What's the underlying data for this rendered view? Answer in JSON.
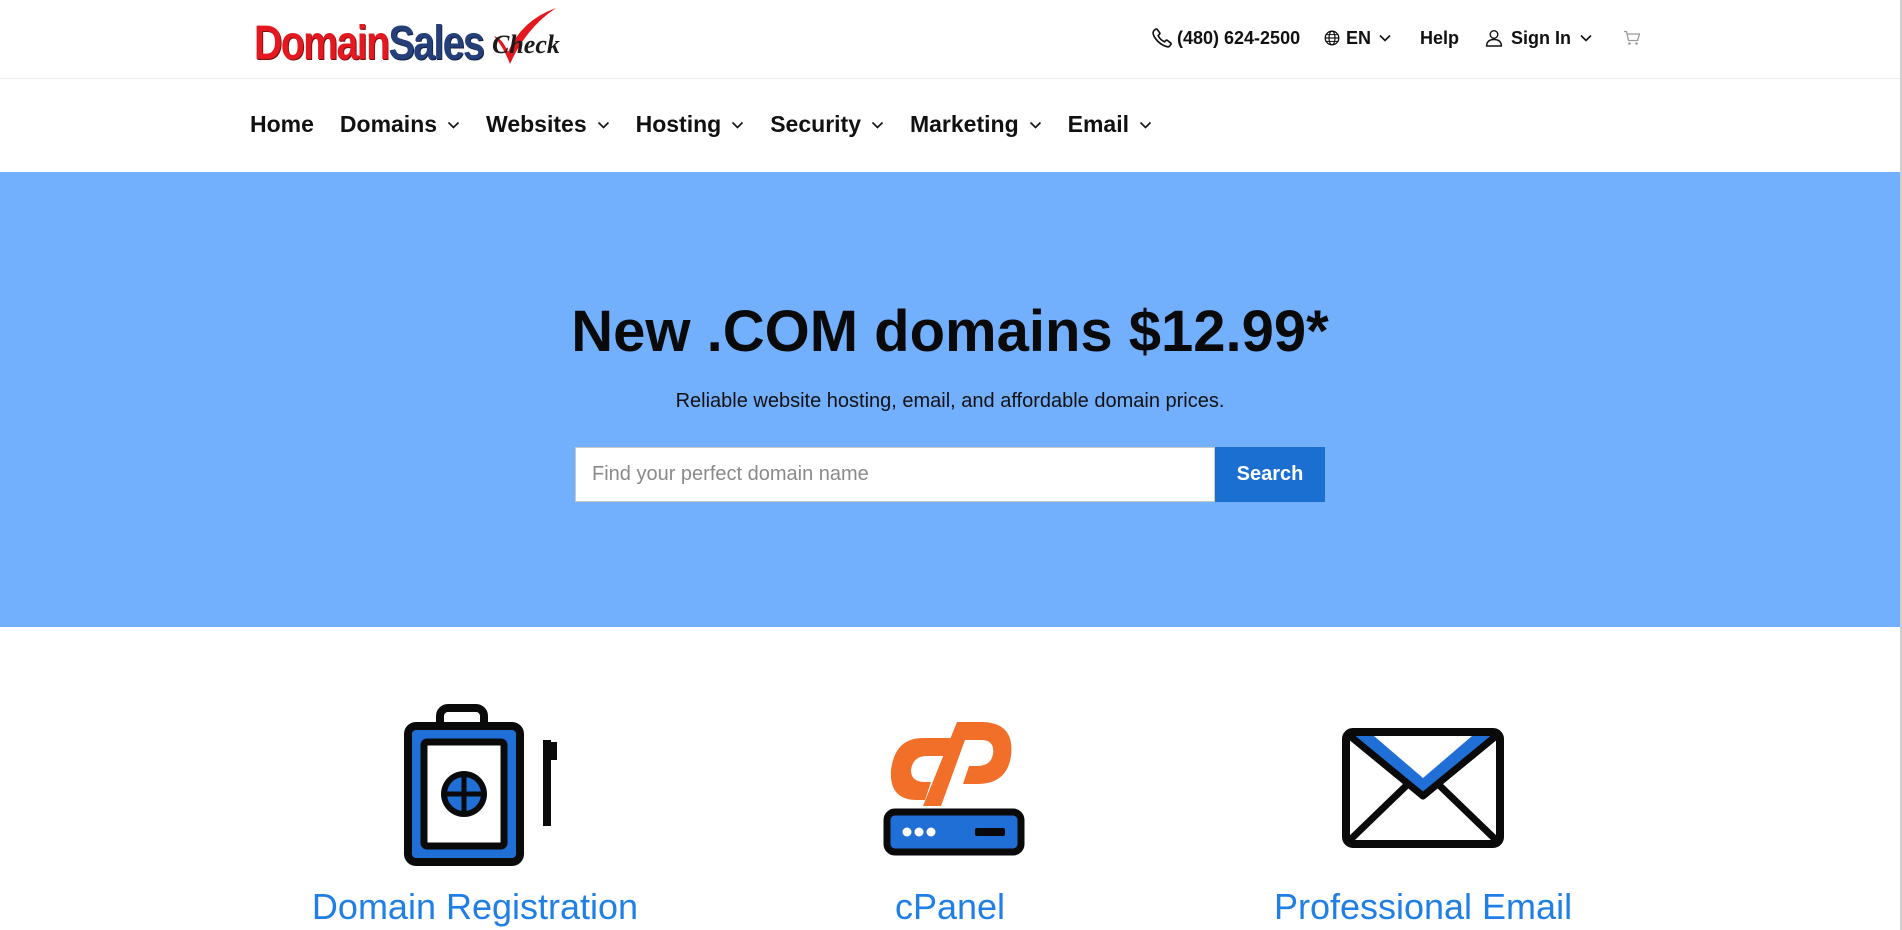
{
  "brand": {
    "logo_part1": "Domain",
    "logo_part2": "Sales",
    "logo_part3": "Check",
    "red": "#e3191f",
    "navy": "#243f7a"
  },
  "utility_nav": {
    "phone": "(480) 624-2500",
    "language": "EN",
    "help": "Help",
    "sign_in": "Sign In",
    "icons": [
      "phone-icon",
      "globe-icon",
      "user-icon",
      "cart-icon",
      "chevron-down-icon"
    ]
  },
  "main_nav": {
    "items": [
      {
        "label": "Home",
        "has_dropdown": false
      },
      {
        "label": "Domains",
        "has_dropdown": true
      },
      {
        "label": "Websites",
        "has_dropdown": true
      },
      {
        "label": "Hosting",
        "has_dropdown": true
      },
      {
        "label": "Security",
        "has_dropdown": true
      },
      {
        "label": "Marketing",
        "has_dropdown": true
      },
      {
        "label": "Email",
        "has_dropdown": true
      }
    ]
  },
  "hero": {
    "title": "New .COM domains $12.99*",
    "subtitle": "Reliable website hosting, email, and affordable domain prices.",
    "search_placeholder": "Find your perfect domain name",
    "search_value": "",
    "search_button": "Search",
    "background": "#72affd",
    "button_color": "#1a6fd0"
  },
  "products": [
    {
      "label": "Domain Registration",
      "icon": "domain-registration-icon"
    },
    {
      "label": "cPanel",
      "icon": "cpanel-icon"
    },
    {
      "label": "Professional Email",
      "icon": "envelope-icon"
    }
  ],
  "colors": {
    "link": "#1f7fe6",
    "icon_blue": "#1f6fd6",
    "cpanel_orange": "#f26f29"
  }
}
